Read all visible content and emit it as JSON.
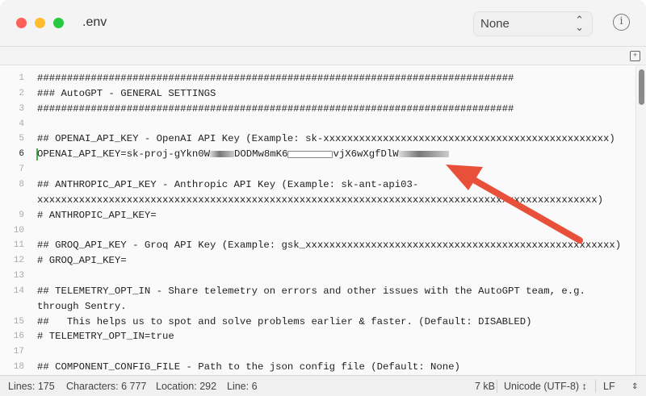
{
  "window": {
    "title": ".env",
    "syntax_select": "None"
  },
  "lines": [
    {
      "n": "1",
      "text": "################################################################################"
    },
    {
      "n": "2",
      "text": "### AutoGPT - GENERAL SETTINGS"
    },
    {
      "n": "3",
      "text": "################################################################################"
    },
    {
      "n": "4",
      "text": ""
    },
    {
      "n": "5",
      "text": "## OPENAI_API_KEY - OpenAI API Key (Example: sk-xxxxxxxxxxxxxxxxxxxxxxxxxxxxxxxxxxxxxxxxxxxxxxxx)"
    },
    {
      "n": "6",
      "parts": [
        "OPENAI_API_KEY=sk-proj-gYkn0W",
        "DODMw8mK6",
        "vjX6wXgfDlW"
      ]
    },
    {
      "n": "7",
      "text": ""
    },
    {
      "n": "8",
      "text": "## ANTHROPIC_API_KEY - Anthropic API Key (Example: sk-ant-api03-",
      "wrap": "xxxxxxxxxxxxxxxxxxxxxxxxxxxxxxxxxxxxxxxxxxxxxxxxxxxxxxxxxxxxxxxxxxxxxxxxxxxxxxxxxxxxxxxxxxxxxx)"
    },
    {
      "n": "9",
      "text": "# ANTHROPIC_API_KEY="
    },
    {
      "n": "10",
      "text": ""
    },
    {
      "n": "11",
      "text": "## GROQ_API_KEY - Groq API Key (Example: gsk_xxxxxxxxxxxxxxxxxxxxxxxxxxxxxxxxxxxxxxxxxxxxxxxxxxxx)"
    },
    {
      "n": "12",
      "text": "# GROQ_API_KEY="
    },
    {
      "n": "13",
      "text": ""
    },
    {
      "n": "14",
      "text": "## TELEMETRY_OPT_IN - Share telemetry on errors and other issues with the AutoGPT team, e.g.",
      "wrap": "through Sentry."
    },
    {
      "n": "15",
      "text": "##   This helps us to spot and solve problems earlier & faster. (Default: DISABLED)"
    },
    {
      "n": "16",
      "text": "# TELEMETRY_OPT_IN=true"
    },
    {
      "n": "17",
      "text": ""
    },
    {
      "n": "18",
      "text": "## COMPONENT_CONFIG_FILE - Path to the json config file (Default: None)"
    }
  ],
  "status": {
    "lines": "Lines: 175",
    "characters": "Characters: 6 777",
    "location": "Location: 292",
    "line": "Line: 6",
    "size": "7 kB",
    "encoding": "Unicode (UTF-8) ↕",
    "line_ending": "LF"
  },
  "colors": {
    "close": "#fe5f57",
    "minimize": "#febc2e",
    "zoom": "#28c840",
    "arrow": "#e8503a"
  }
}
